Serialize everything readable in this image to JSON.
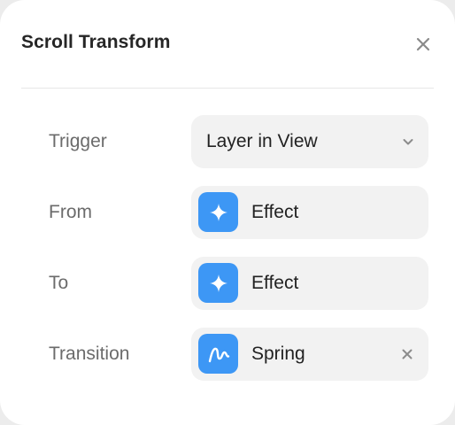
{
  "panel": {
    "title": "Scroll Transform"
  },
  "rows": {
    "trigger": {
      "label": "Trigger",
      "value": "Layer in View",
      "icon": "chevron-down-icon"
    },
    "from": {
      "label": "From",
      "value": "Effect",
      "icon": "sparkle-icon"
    },
    "to": {
      "label": "To",
      "value": "Effect",
      "icon": "sparkle-icon"
    },
    "transition": {
      "label": "Transition",
      "value": "Spring",
      "icon": "spring-curve-icon"
    }
  },
  "colors": {
    "accent": "#3d97f5",
    "control_bg": "#f2f2f2",
    "label": "#6b6b6b",
    "text": "#222222"
  }
}
